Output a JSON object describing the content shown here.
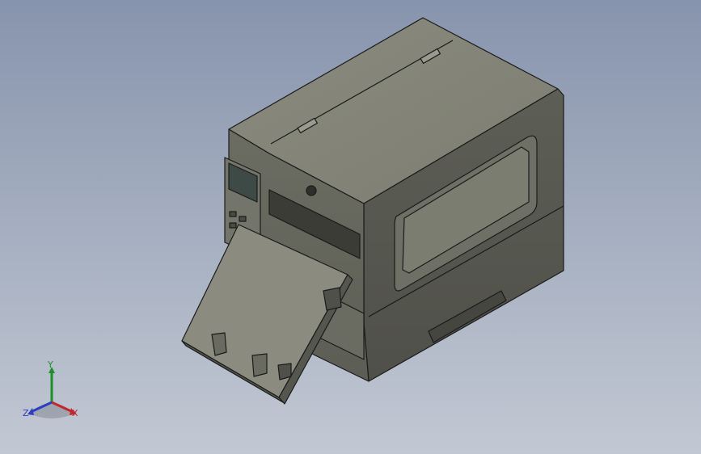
{
  "viewport": {
    "background_top": "#8794ad",
    "background_bottom": "#c2c8d3"
  },
  "model": {
    "body_color": "#7a7b6e",
    "edge_color": "#1a1a1a"
  },
  "triad": {
    "x_label": "X",
    "y_label": "Y",
    "z_label": "Z",
    "x_color": "#c0282d",
    "y_color": "#1f8f2a",
    "z_color": "#2b3fbf"
  }
}
